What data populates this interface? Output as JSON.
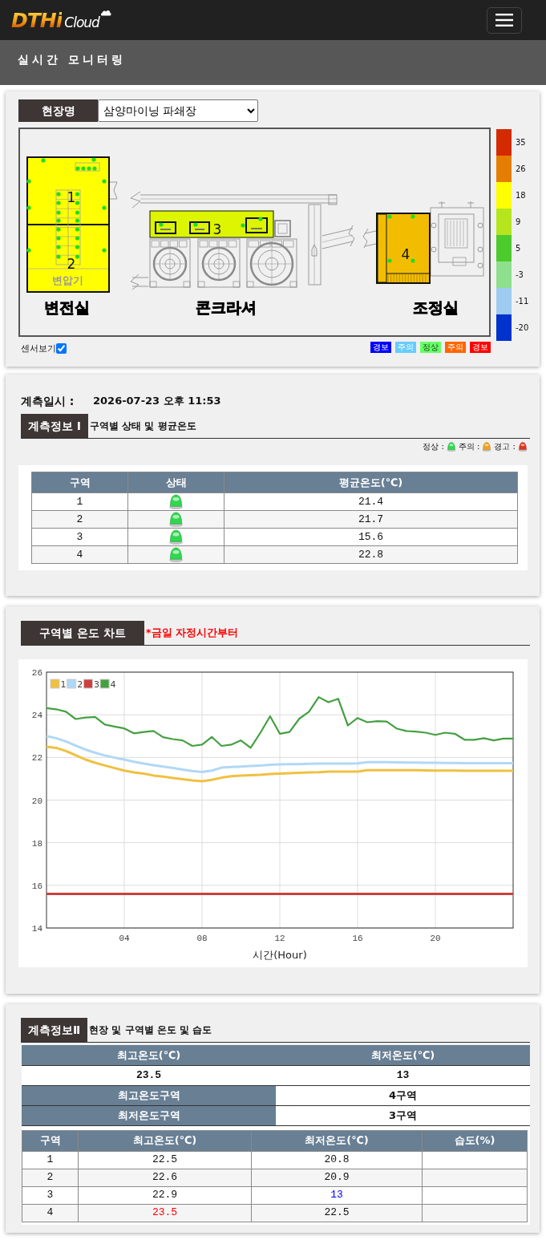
{
  "navbar": {
    "brand_primary": "DTHi",
    "brand_secondary": "Cloud"
  },
  "page_title": "실시간 모니터링",
  "site_panel": {
    "label": "현장명",
    "value": "삼양마이닝 파쇄장",
    "map": {
      "buildings": [
        "변전실",
        "콘크라셔",
        "조정실"
      ],
      "equipment_label": "변압기",
      "zones": [
        {
          "number": "1",
          "color": "#ffff00"
        },
        {
          "number": "2",
          "color": "#ffff00"
        },
        {
          "number": "3",
          "color": "#ddf500"
        },
        {
          "number": "4",
          "color": "#f2bd00"
        }
      ]
    },
    "scale": [
      {
        "label": "35",
        "color": "#d42a00"
      },
      {
        "label": "26",
        "color": "#e57e00"
      },
      {
        "label": "18",
        "color": "#ffff00"
      },
      {
        "label": "9",
        "color": "#b5e61d"
      },
      {
        "label": "5",
        "color": "#4ccb2c"
      },
      {
        "label": "-3",
        "color": "#8ee08e"
      },
      {
        "label": "-11",
        "color": "#9fcbf0"
      },
      {
        "label": "-20",
        "color": "#0033cc"
      }
    ],
    "show_sensors": {
      "label": "센서보기",
      "checked": true
    },
    "alert_legend": [
      {
        "label": "경보",
        "color": "#0000ff"
      },
      {
        "label": "주의",
        "color": "#66ccff"
      },
      {
        "label": "정상",
        "color": "#66ff66"
      },
      {
        "label": "주의",
        "color": "#ff6600"
      },
      {
        "label": "경보",
        "color": "#ff0000"
      }
    ]
  },
  "measurement": {
    "label": "계측일시 :",
    "value": "2026-07-23 오후 11:53",
    "tab": "계측정보 Ⅰ",
    "subtitle": "구역별 상태 및 평균온도",
    "status_legend": [
      {
        "label": "정상 :",
        "color": "#2fd84f"
      },
      {
        "label": "주의 :",
        "color": "#f0a11c"
      },
      {
        "label": "경고 :",
        "color": "#e2321f"
      }
    ],
    "columns": [
      "구역",
      "상태",
      "평균온도(℃)"
    ],
    "rows": [
      {
        "zone": "1",
        "color": "#2fd84f",
        "avg": "21.4"
      },
      {
        "zone": "2",
        "color": "#2fd84f",
        "avg": "21.7"
      },
      {
        "zone": "3",
        "color": "#2fd84f",
        "avg": "15.6"
      },
      {
        "zone": "4",
        "color": "#2fd84f",
        "avg": "22.8"
      }
    ]
  },
  "chart": {
    "tab": "구역별 온도 차트",
    "note": "*금일 자정시간부터",
    "chart_data": {
      "type": "line",
      "xlabel": "시간(Hour)",
      "x": [
        0,
        0.5,
        1,
        1.5,
        2,
        2.5,
        3,
        3.5,
        4,
        4.5,
        5,
        5.5,
        6,
        6.5,
        7,
        7.5,
        8,
        8.5,
        9,
        9.5,
        10,
        10.5,
        11,
        11.5,
        12,
        12.5,
        13,
        13.5,
        14,
        14.5,
        15,
        15.5,
        16,
        16.5,
        17,
        17.5,
        18,
        18.5,
        19,
        19.5,
        20,
        20.5,
        21,
        21.5,
        22,
        22.5,
        23,
        23.5,
        24
      ],
      "series": [
        {
          "name": "1",
          "color": "#f0c040",
          "values": [
            22.5,
            22.45,
            22.3,
            22.1,
            21.9,
            21.75,
            21.62,
            21.5,
            21.38,
            21.3,
            21.24,
            21.15,
            21.1,
            21.04,
            20.98,
            20.92,
            20.88,
            20.95,
            21.05,
            21.12,
            21.15,
            21.17,
            21.19,
            21.22,
            21.24,
            21.26,
            21.28,
            21.3,
            21.31,
            21.33,
            21.34,
            21.34,
            21.34,
            21.4,
            21.4,
            21.4,
            21.4,
            21.4,
            21.4,
            21.39,
            21.38,
            21.38,
            21.38,
            21.37,
            21.37,
            21.37,
            21.37,
            21.37,
            21.37
          ]
        },
        {
          "name": "2",
          "color": "#b0d8f5",
          "values": [
            23.0,
            22.9,
            22.75,
            22.55,
            22.37,
            22.22,
            22.09,
            21.99,
            21.9,
            21.8,
            21.71,
            21.64,
            21.57,
            21.5,
            21.43,
            21.36,
            21.32,
            21.38,
            21.52,
            21.55,
            21.57,
            21.6,
            21.62,
            21.65,
            21.67,
            21.68,
            21.68,
            21.7,
            21.71,
            21.71,
            21.71,
            21.71,
            21.72,
            21.78,
            21.78,
            21.78,
            21.77,
            21.76,
            21.76,
            21.75,
            21.75,
            21.74,
            21.74,
            21.73,
            21.73,
            21.73,
            21.73,
            21.73,
            21.73
          ]
        },
        {
          "name": "3",
          "color": "#cc4040",
          "values": [
            15.6,
            15.6,
            15.6,
            15.6,
            15.6,
            15.6,
            15.6,
            15.6,
            15.6,
            15.6,
            15.6,
            15.6,
            15.6,
            15.6,
            15.6,
            15.6,
            15.6,
            15.6,
            15.6,
            15.6,
            15.6,
            15.6,
            15.6,
            15.6,
            15.6,
            15.6,
            15.6,
            15.6,
            15.6,
            15.6,
            15.6,
            15.6,
            15.6,
            15.6,
            15.6,
            15.6,
            15.6,
            15.6,
            15.6,
            15.6,
            15.6,
            15.6,
            15.6,
            15.6,
            15.6,
            15.6,
            15.6,
            15.6,
            15.6
          ]
        },
        {
          "name": "4",
          "color": "#44a040",
          "values": [
            24.31,
            24.26,
            24.14,
            23.8,
            23.87,
            23.9,
            23.54,
            23.45,
            23.36,
            23.13,
            23.19,
            23.24,
            22.95,
            22.86,
            22.8,
            22.54,
            22.6,
            22.96,
            22.54,
            22.6,
            22.8,
            22.45,
            23.16,
            23.93,
            23.11,
            23.19,
            23.82,
            24.14,
            24.83,
            24.59,
            24.75,
            23.5,
            23.85,
            23.65,
            23.7,
            23.68,
            23.36,
            23.24,
            23.21,
            23.16,
            23.06,
            23.16,
            23.11,
            22.83,
            22.83,
            22.9,
            22.8,
            22.88,
            22.88
          ]
        }
      ],
      "xlim": [
        0,
        24
      ],
      "ylim": [
        14,
        26
      ],
      "xticks": [
        {
          "value": 4,
          "label": "04"
        },
        {
          "value": 8,
          "label": "08"
        },
        {
          "value": 12,
          "label": "12"
        },
        {
          "value": 16,
          "label": "16"
        },
        {
          "value": 20,
          "label": "20"
        }
      ],
      "yticks": [
        {
          "value": 14,
          "label": "14"
        },
        {
          "value": 16,
          "label": "16"
        },
        {
          "value": 18,
          "label": "18"
        },
        {
          "value": 20,
          "label": "20"
        },
        {
          "value": 22,
          "label": "22"
        },
        {
          "value": 24,
          "label": "24"
        },
        {
          "value": 26,
          "label": "26"
        }
      ],
      "grid": true,
      "legend": true
    }
  },
  "details": {
    "tab": "계측정보Ⅱ",
    "subtitle": "현장 및 구역별 온도 및 습도",
    "summary": {
      "max_label": "최고온도(℃)",
      "min_label": "최저온도(℃)",
      "max_value": "23.5",
      "min_value": "13",
      "rows": [
        {
          "label": "최고온도구역",
          "value": "4구역"
        },
        {
          "label": "최저온도구역",
          "value": "3구역"
        }
      ]
    },
    "columns": [
      "구역",
      "최고온도(℃)",
      "최저온도(℃)",
      "습도(%)"
    ],
    "rows": [
      {
        "zone": "1",
        "max": "22.5",
        "min": "20.8",
        "max_is_highest": false,
        "min_is_lowest": false
      },
      {
        "zone": "2",
        "max": "22.6",
        "min": "20.9",
        "max_is_highest": false,
        "min_is_lowest": false
      },
      {
        "zone": "3",
        "max": "22.9",
        "min": "13",
        "max_is_highest": false,
        "min_is_lowest": true
      },
      {
        "zone": "4",
        "max": "23.5",
        "min": "22.5",
        "max_is_highest": true,
        "min_is_lowest": false
      }
    ]
  }
}
